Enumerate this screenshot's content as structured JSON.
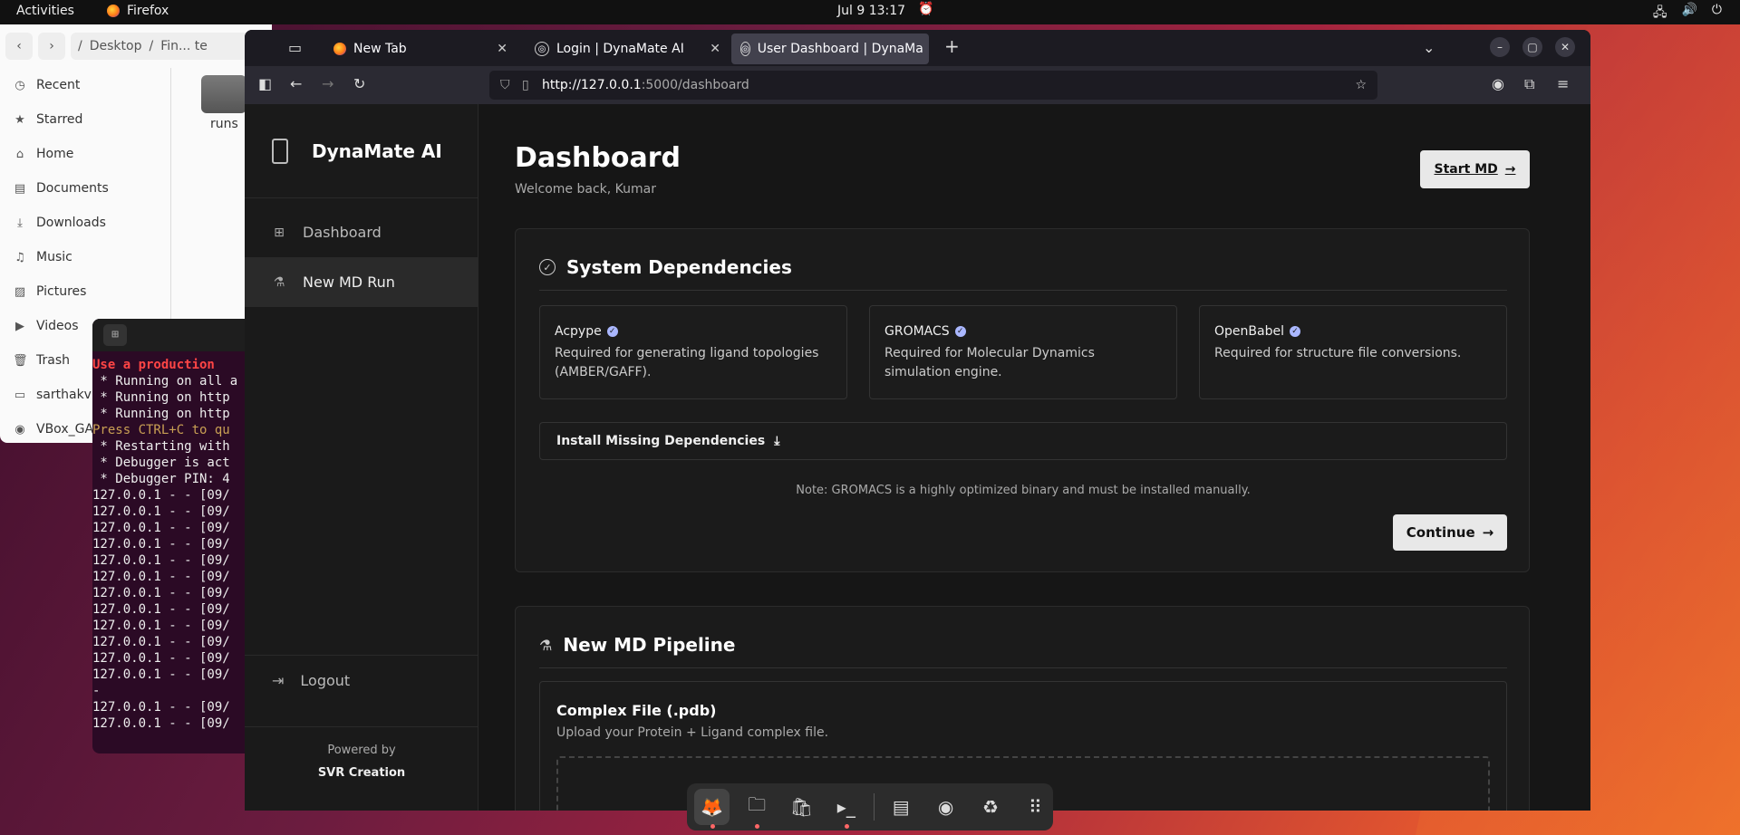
{
  "topbar": {
    "activities": "Activities",
    "app": "Firefox",
    "clock": "Jul 9  13:17"
  },
  "files": {
    "path_desktop": "Desktop",
    "path_more": "Fin... te",
    "sidebar": [
      {
        "label": "Recent",
        "icon": "clock-icon"
      },
      {
        "label": "Starred",
        "icon": "star-icon"
      },
      {
        "label": "Home",
        "icon": "home-icon"
      },
      {
        "label": "Documents",
        "icon": "document-icon"
      },
      {
        "label": "Downloads",
        "icon": "download-icon"
      },
      {
        "label": "Music",
        "icon": "music-icon"
      },
      {
        "label": "Pictures",
        "icon": "picture-icon"
      },
      {
        "label": "Videos",
        "icon": "video-icon"
      },
      {
        "label": "Trash",
        "icon": "trash-icon"
      },
      {
        "label": "sarthakvm",
        "icon": "drive-icon"
      },
      {
        "label": "VBox_GAs",
        "icon": "disc-icon"
      }
    ],
    "folder_label": "runs"
  },
  "terminal": {
    "title_char": "s",
    "lines": [
      {
        "text": "Use a production ",
        "cls": "t-red"
      },
      {
        "text": " * Running on all a",
        "cls": ""
      },
      {
        "text": " * Running on http",
        "cls": ""
      },
      {
        "text": " * Running on http",
        "cls": ""
      },
      {
        "text": "Press CTRL+C to qu",
        "cls": "t-yel"
      },
      {
        "text": " * Restarting with",
        "cls": ""
      },
      {
        "text": " * Debugger is act",
        "cls": ""
      },
      {
        "text": " * Debugger PIN: 4",
        "cls": ""
      },
      {
        "text": "127.0.0.1 - - [09/",
        "cls": ""
      },
      {
        "text": "127.0.0.1 - - [09/",
        "cls": ""
      },
      {
        "text": "127.0.0.1 - - [09/",
        "cls": ""
      },
      {
        "text": "127.0.0.1 - - [09/",
        "cls": ""
      },
      {
        "text": "127.0.0.1 - - [09/",
        "cls": ""
      },
      {
        "text": "127.0.0.1 - - [09/",
        "cls": ""
      },
      {
        "text": "127.0.0.1 - - [09/",
        "cls": ""
      },
      {
        "text": "127.0.0.1 - - [09/",
        "cls": ""
      },
      {
        "text": "127.0.0.1 - - [09/",
        "cls": ""
      },
      {
        "text": "127.0.0.1 - - [09/",
        "cls": ""
      },
      {
        "text": "127.0.0.1 - - [09/",
        "cls": ""
      },
      {
        "text": "127.0.0.1 - - [09/",
        "cls": ""
      },
      {
        "text": "-",
        "cls": ""
      },
      {
        "text": "127.0.0.1 - - [09/",
        "cls": ""
      },
      {
        "text": "127.0.0.1 - - [09/",
        "cls": ""
      }
    ]
  },
  "browser": {
    "tabs": [
      {
        "label": "New Tab",
        "active": false
      },
      {
        "label": "Login | DynaMate AI",
        "active": false
      },
      {
        "label": "User Dashboard | DynaMa",
        "active": true
      }
    ],
    "url_host": "http://127.0.0.1",
    "url_path": ":5000/dashboard"
  },
  "app": {
    "brand": "DynaMate AI",
    "nav": [
      {
        "label": "Dashboard",
        "icon": "grid-icon",
        "selected": false
      },
      {
        "label": "New MD Run",
        "icon": "flask-icon",
        "selected": true
      }
    ],
    "logout": "Logout",
    "powered_by": "Powered by",
    "powered_name": "SVR Creation",
    "page_title": "Dashboard",
    "page_subtitle": "Welcome back, Kumar",
    "start_button": "Start MD",
    "deps": {
      "title": "System Dependencies",
      "items": [
        {
          "name": "Acpype",
          "desc": "Required for generating ligand topologies (AMBER/GAFF)."
        },
        {
          "name": "GROMACS",
          "desc": "Required for Molecular Dynamics simulation engine."
        },
        {
          "name": "OpenBabel",
          "desc": "Required for structure file conversions."
        }
      ],
      "install": "Install Missing Dependencies",
      "note": "Note: GROMACS is a highly optimized binary and must be installed manually.",
      "continue": "Continue"
    },
    "pipeline": {
      "title": "New MD Pipeline",
      "file_title": "Complex File (.pdb)",
      "file_sub": "Upload your Protein + Ligand complex file."
    }
  },
  "dock": [
    {
      "name": "firefox-icon",
      "running": true
    },
    {
      "name": "files-icon",
      "running": true
    },
    {
      "name": "app-center-icon",
      "running": false
    },
    {
      "name": "terminal-icon",
      "running": true
    },
    {
      "name": "text-editor-icon",
      "running": false
    },
    {
      "name": "disc-icon",
      "running": false
    },
    {
      "name": "recycle-icon",
      "running": false
    },
    {
      "name": "app-grid-icon",
      "running": false
    }
  ]
}
